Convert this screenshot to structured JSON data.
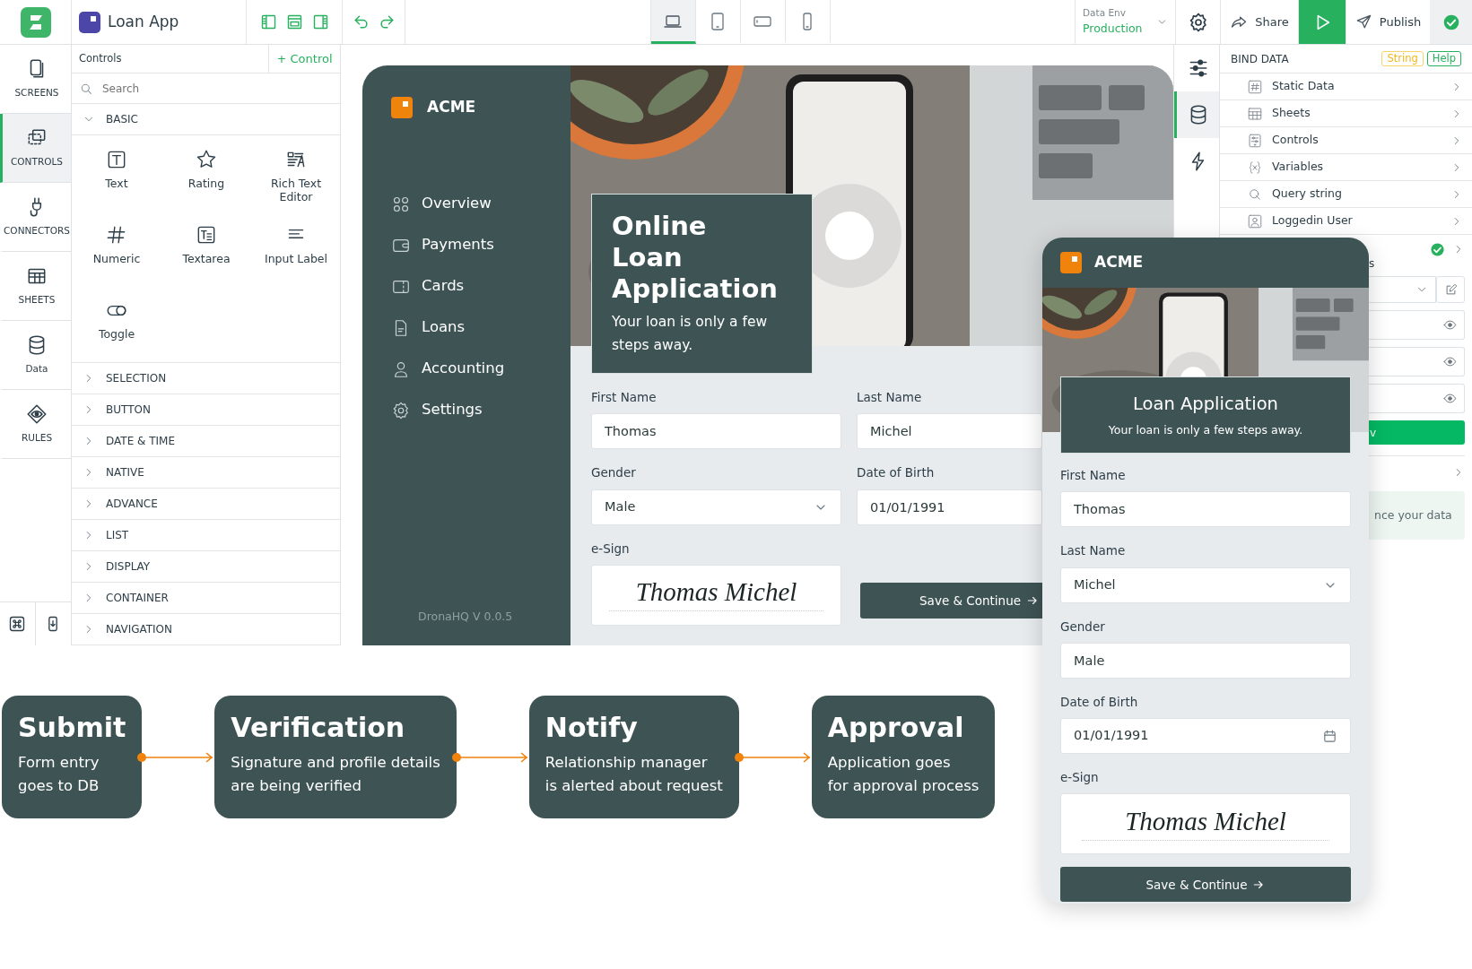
{
  "topbar": {
    "app_name": "Loan App",
    "devices": [
      {
        "kind": "laptop",
        "selected": true
      },
      {
        "kind": "tablet",
        "selected": false
      },
      {
        "kind": "tablet-landscape",
        "selected": false
      },
      {
        "kind": "phone",
        "selected": false
      }
    ],
    "data_env": {
      "label": "Data Env",
      "value": "Production"
    },
    "share": "Share",
    "publish": "Publish"
  },
  "rail": {
    "items": [
      {
        "label": "SCREENS",
        "kind": "screens",
        "selected": false
      },
      {
        "label": "CONTROLS",
        "kind": "controls",
        "selected": true
      },
      {
        "label": "CONNECTORS",
        "kind": "connectors",
        "selected": false
      },
      {
        "label": "SHEETS",
        "kind": "sheets",
        "selected": false
      },
      {
        "label": "Data",
        "kind": "data",
        "selected": false
      },
      {
        "label": "RULES",
        "kind": "rules",
        "selected": false
      }
    ]
  },
  "controls_panel": {
    "title": "Controls",
    "add_button": "+ Control",
    "search": {
      "placeholder": "Search"
    },
    "groups": [
      {
        "label": "BASIC",
        "expanded": true,
        "items": [
          {
            "label": "Text",
            "kind": "text"
          },
          {
            "label": "Rating",
            "kind": "rating"
          },
          {
            "label": "Rich Text Editor",
            "kind": "rich-text"
          },
          {
            "label": "Numeric",
            "kind": "numeric"
          },
          {
            "label": "Textarea",
            "kind": "textarea"
          },
          {
            "label": "Input Label",
            "kind": "input-label"
          },
          {
            "label": "Toggle",
            "kind": "toggle"
          }
        ]
      },
      {
        "label": "SELECTION",
        "expanded": false
      },
      {
        "label": "BUTTON",
        "expanded": false
      },
      {
        "label": "DATE & TIME",
        "expanded": false
      },
      {
        "label": "NATIVE",
        "expanded": false
      },
      {
        "label": "ADVANCE",
        "expanded": false
      },
      {
        "label": "LIST",
        "expanded": false
      },
      {
        "label": "DISPLAY",
        "expanded": false
      },
      {
        "label": "CONTAINER",
        "expanded": false
      },
      {
        "label": "NAVIGATION",
        "expanded": false
      }
    ]
  },
  "desktop_preview": {
    "brand": "ACME",
    "nav": [
      {
        "label": "Overview",
        "kind": "grid"
      },
      {
        "label": "Payments",
        "kind": "wallet"
      },
      {
        "label": "Cards",
        "kind": "cards"
      },
      {
        "label": "Loans",
        "kind": "doc"
      },
      {
        "label": "Accounting",
        "kind": "person"
      },
      {
        "label": "Settings",
        "kind": "gear"
      }
    ],
    "version": "DronaHQ V 0.0.5",
    "hero_title_lines": [
      "Online",
      "Loan",
      "Application"
    ],
    "hero_subtitle": "Your loan is only a few steps away.",
    "fields": [
      {
        "label": "First Name",
        "value": "Thomas",
        "kind": "text"
      },
      {
        "label": "Last Name",
        "value": "Michel",
        "kind": "text"
      },
      {
        "label": "Gender",
        "value": "Male",
        "kind": "select"
      },
      {
        "label": "Date of Birth",
        "value": "01/01/1991",
        "kind": "text"
      }
    ],
    "esign": {
      "label": "e-Sign",
      "signature": "Thomas Michel"
    },
    "button": "Save & Continue"
  },
  "properties": {
    "tabs": [
      {
        "kind": "sliders",
        "selected": false
      },
      {
        "kind": "database",
        "selected": true
      },
      {
        "kind": "bolt",
        "selected": false
      }
    ],
    "title": "BIND DATA",
    "type_badge": "String",
    "help": "Help",
    "sources": [
      {
        "label": "Static Data",
        "kind": "hash"
      },
      {
        "label": "Sheets",
        "kind": "table"
      },
      {
        "label": "Controls",
        "kind": "controls"
      },
      {
        "label": "Variables",
        "kind": "variables"
      },
      {
        "label": "Query string",
        "kind": "query"
      },
      {
        "label": "Loggedin User",
        "kind": "user"
      }
    ],
    "partial_rows": [
      {
        "kind": "status",
        "checked": true
      },
      {
        "kind": "text",
        "text": "s"
      },
      {
        "kind": "select"
      },
      {
        "kind": "field"
      },
      {
        "kind": "field"
      },
      {
        "kind": "field"
      },
      {
        "kind": "button",
        "text": "v"
      },
      {
        "kind": "link"
      },
      {
        "kind": "note",
        "text": "nce your data"
      }
    ]
  },
  "mobile_preview": {
    "brand": "ACME",
    "hero_title": "Loan Application",
    "hero_subtitle": "Your loan is only a few steps away.",
    "fields": [
      {
        "label": "First Name",
        "value": "Thomas",
        "kind": "text"
      },
      {
        "label": "Last Name",
        "value": "Michel",
        "kind": "select"
      },
      {
        "label": "Gender",
        "value": "Male",
        "kind": "text"
      },
      {
        "label": "Date of Birth",
        "value": "01/01/1991",
        "kind": "date"
      }
    ],
    "esign": {
      "label": "e-Sign",
      "signature": "Thomas Michel"
    },
    "button": "Save & Continue"
  },
  "flow": {
    "steps": [
      {
        "title": "Submit",
        "lines": [
          "Form entry",
          "goes to DB"
        ]
      },
      {
        "title": "Verification",
        "lines": [
          "Signature and profile details",
          "are being verified"
        ]
      },
      {
        "title": "Notify",
        "lines": [
          "Relationship manager",
          "is alerted about request"
        ]
      },
      {
        "title": "Approval",
        "lines": [
          "Application goes",
          "for approval process"
        ]
      }
    ]
  }
}
